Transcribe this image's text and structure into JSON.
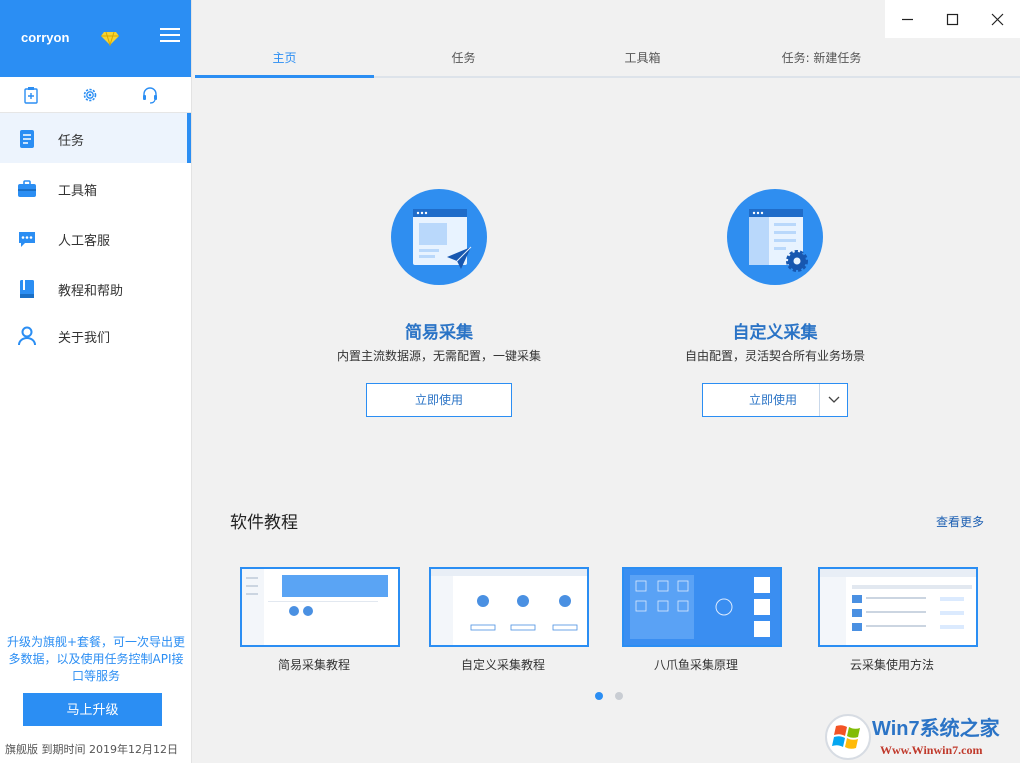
{
  "sidebar": {
    "username": "corryon",
    "items": [
      {
        "label": "任务"
      },
      {
        "label": "工具箱"
      },
      {
        "label": "人工客服"
      },
      {
        "label": "教程和帮助"
      },
      {
        "label": "关于我们"
      }
    ],
    "upgrade_text": "升级为旗舰+套餐，可一次导出更多数据，以及使用任务控制API接口等服务",
    "upgrade_button": "马上升级",
    "footer": "旗舰版  到期时间 2019年12月12日"
  },
  "tabs": [
    {
      "label": "主页"
    },
    {
      "label": "任务"
    },
    {
      "label": "工具箱"
    },
    {
      "label": "任务: 新建任务"
    }
  ],
  "features": [
    {
      "title": "简易采集",
      "subtitle": "内置主流数据源，无需配置，一键采集",
      "button": "立即使用"
    },
    {
      "title": "自定义采集",
      "subtitle": "自由配置，灵活契合所有业务场景",
      "button": "立即使用"
    }
  ],
  "tutorials": {
    "title": "软件教程",
    "more": "查看更多",
    "items": [
      {
        "label": "简易采集教程"
      },
      {
        "label": "自定义采集教程"
      },
      {
        "label": "八爪鱼采集原理"
      },
      {
        "label": "云采集使用方法"
      }
    ],
    "carousel_active_index": 0
  },
  "watermark": {
    "brand": "Win7系统之家",
    "url": "Www.Winwin7.com"
  },
  "colors": {
    "accent": "#2b8ef3",
    "title_blue": "#2b74c6",
    "background": "#f1f1f1"
  }
}
